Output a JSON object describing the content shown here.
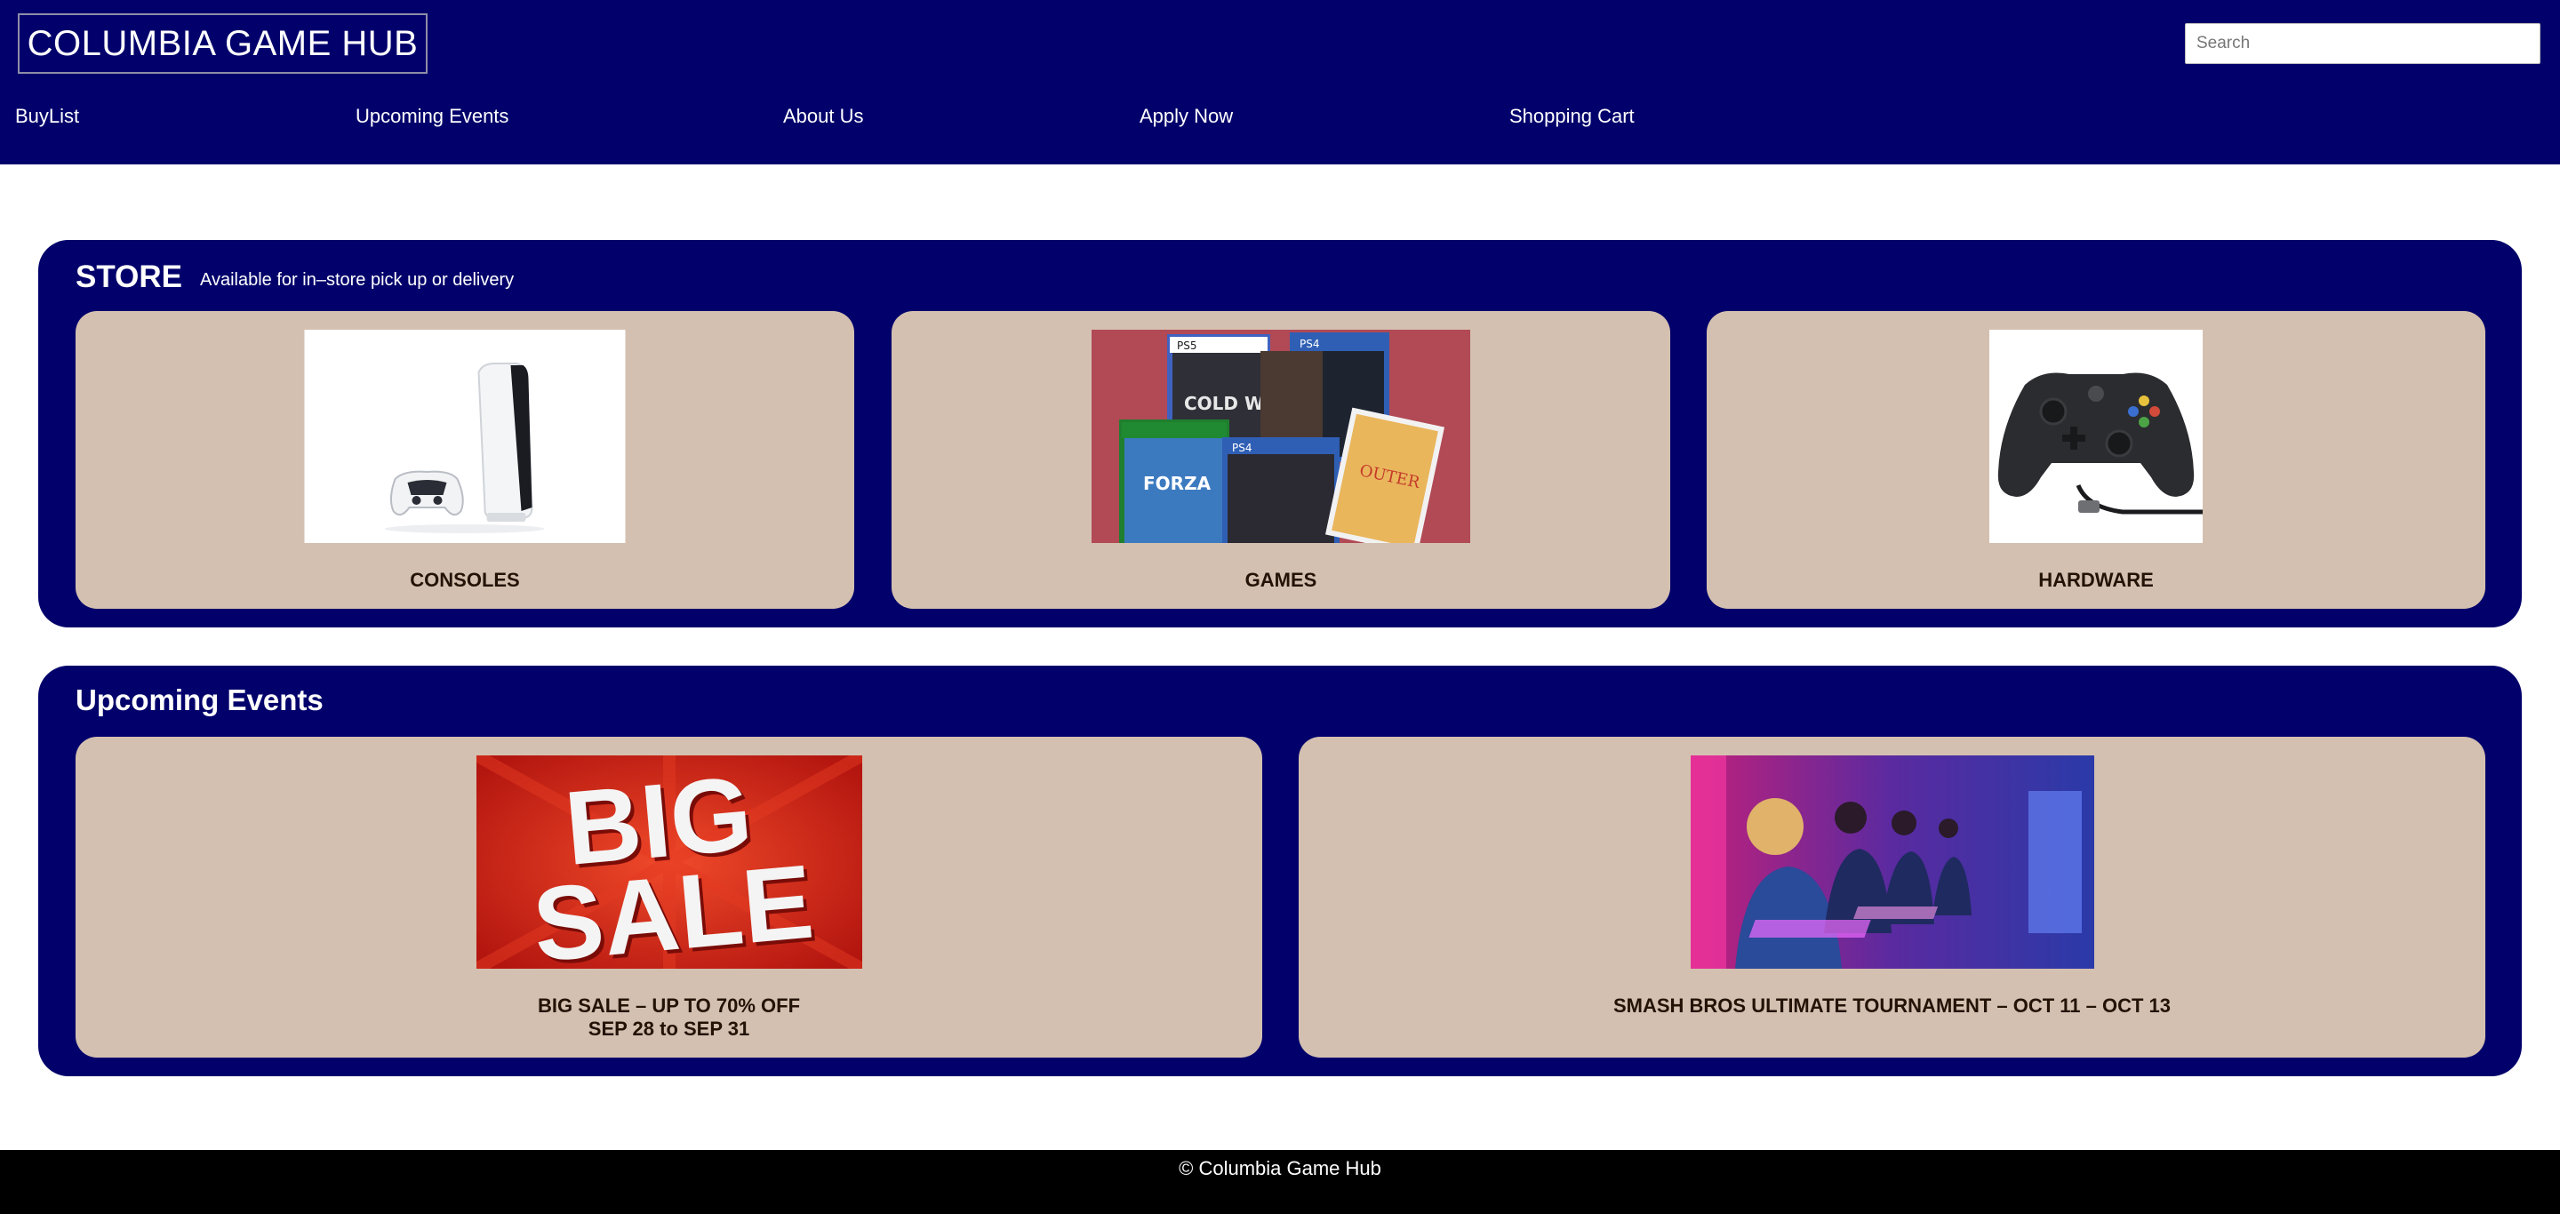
{
  "header": {
    "logo_text": "COLUMBIA GAME HUB",
    "search_placeholder": "Search",
    "background": "#02016b"
  },
  "nav": {
    "items": [
      {
        "label": "BuyList"
      },
      {
        "label": "Upcoming Events"
      },
      {
        "label": "About Us"
      },
      {
        "label": "Apply Now"
      },
      {
        "label": "Shopping Cart"
      }
    ]
  },
  "store": {
    "title": "STORE",
    "subtitle": "Available for in–store pick up or delivery",
    "cards": [
      {
        "label": "CONSOLES",
        "image": "console-image"
      },
      {
        "label": "GAMES",
        "image": "games-image"
      },
      {
        "label": "HARDWARE",
        "image": "controller-image"
      }
    ]
  },
  "events": {
    "title": "Upcoming Events",
    "cards": [
      {
        "label_line1": "BIG SALE – UP TO 70% OFF",
        "label_line2": "SEP 28 to SEP 31",
        "image": "big-sale-image",
        "image_text_1": "BIG",
        "image_text_2": "SALE"
      },
      {
        "label_line1": "SMASH BROS ULTIMATE TOURNAMENT – OCT 11 – OCT 13",
        "image": "gaming-tournament-image"
      }
    ]
  },
  "footer": {
    "text": "© Columbia Game Hub"
  },
  "colors": {
    "navy": "#02016b",
    "card": "#d4c0b0",
    "card_text": "#231307",
    "footer": "#000000"
  }
}
